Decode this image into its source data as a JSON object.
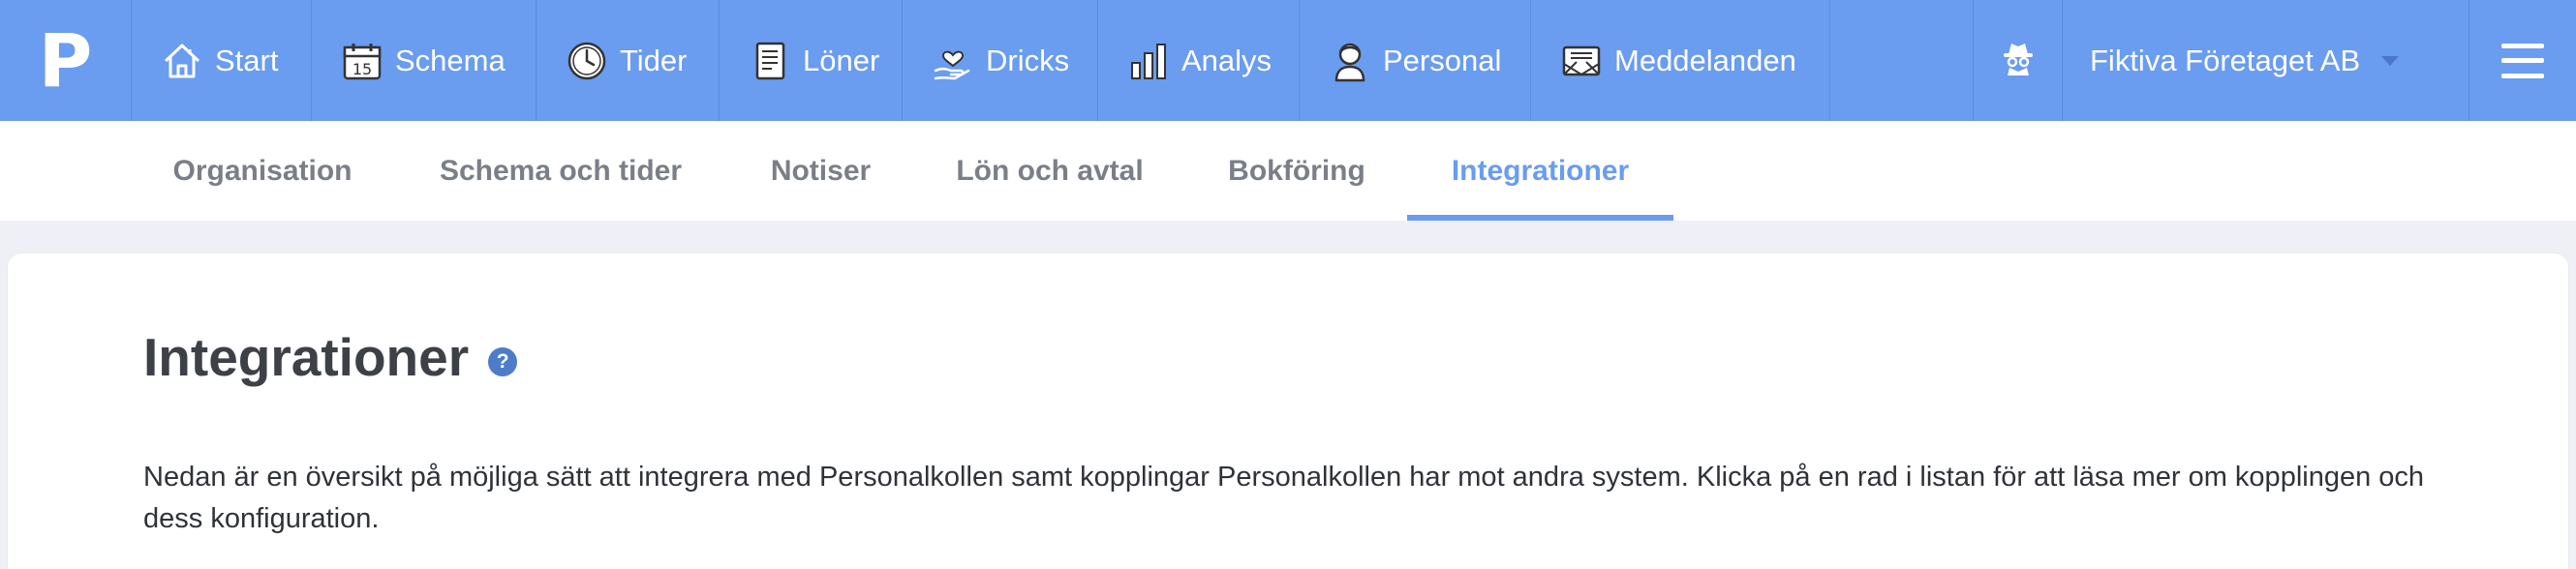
{
  "brand": {
    "logo_letter": "P"
  },
  "nav": {
    "items": [
      {
        "label": "Start",
        "icon": "home-icon"
      },
      {
        "label": "Schema",
        "icon": "calendar-icon",
        "calendar_day": "15"
      },
      {
        "label": "Tider",
        "icon": "clock-icon"
      },
      {
        "label": "Löner",
        "icon": "payslip-icon"
      },
      {
        "label": "Dricks",
        "icon": "hand-heart-icon"
      },
      {
        "label": "Analys",
        "icon": "bar-chart-icon"
      },
      {
        "label": "Personal",
        "icon": "person-icon"
      },
      {
        "label": "Meddelanden",
        "icon": "envelope-icon"
      }
    ],
    "spy_icon": "incognito-icon",
    "company": "Fiktiva Företaget AB",
    "menu_icon": "hamburger-menu-icon"
  },
  "subnav": {
    "tabs": [
      {
        "label": "Organisation"
      },
      {
        "label": "Schema och tider"
      },
      {
        "label": "Notiser"
      },
      {
        "label": "Lön och avtal"
      },
      {
        "label": "Bokföring"
      },
      {
        "label": "Integrationer"
      }
    ],
    "active": "Integrationer"
  },
  "main": {
    "title": "Integrationer",
    "help_symbol": "?",
    "description": "Nedan är en översikt på möjliga sätt att integrera med Personalkollen samt kopplingar Personalkollen har mot andra system. Klicka på en rad i listan för att läsa mer om kopplingen och dess konfiguration."
  },
  "colors": {
    "nav_bg": "#6a9cf0",
    "accent": "#6a9cf0",
    "help_badge": "#4d7cc9",
    "page_bg": "#eef0f5"
  }
}
